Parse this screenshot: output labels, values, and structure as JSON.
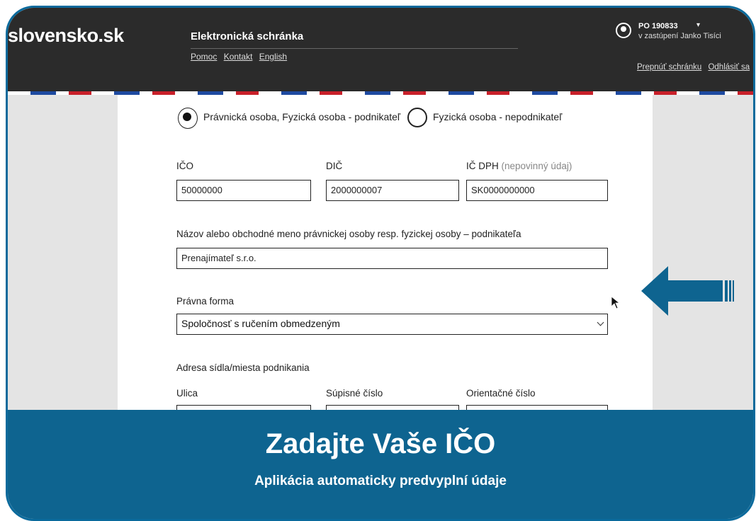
{
  "header": {
    "logo": "slovensko.sk",
    "app_title": "Elektronická schránka",
    "links": [
      "Pomoc",
      "Kontakt",
      "English"
    ],
    "account": {
      "id": "PO 190833",
      "caret": "▾",
      "subtitle": "v zastúpení Janko Tisíci",
      "links": [
        "Prepnúť schránku",
        "Odhlásiť sa"
      ]
    }
  },
  "form": {
    "radio_options": [
      {
        "label": "Právnická osoba, Fyzická osoba - podnikateľ",
        "selected": true
      },
      {
        "label": "Fyzická osoba - nepodnikateľ",
        "selected": false
      }
    ],
    "ico": {
      "label": "IČO",
      "value": "50000000"
    },
    "dic": {
      "label": "DIČ",
      "value": "2000000007"
    },
    "icdph": {
      "label": "IČ DPH",
      "optional": "(nepovinný údaj)",
      "value": "SK0000000000"
    },
    "nazov": {
      "label": "Názov alebo obchodné meno právnickej osoby resp. fyzickej osoby – podnikateľa",
      "value": "Prenajímateľ s.r.o."
    },
    "pravna_forma": {
      "label": "Právna forma",
      "value": "Spoločnosť s ručením obmedzeným"
    },
    "adresa": {
      "section_label": "Adresa sídla/miesta podnikania",
      "ulica_label": "Ulica",
      "supisne_label": "Súpisné číslo",
      "orientacne_label": "Orientačné číslo"
    }
  },
  "banner": {
    "headline": "Zadajte Vaše IČO",
    "subline": "Aplikácia automaticky predvyplní údaje"
  },
  "colors": {
    "banner": "#0e6490",
    "topbar": "#2b2b2b",
    "arrow": "#0e6490"
  }
}
